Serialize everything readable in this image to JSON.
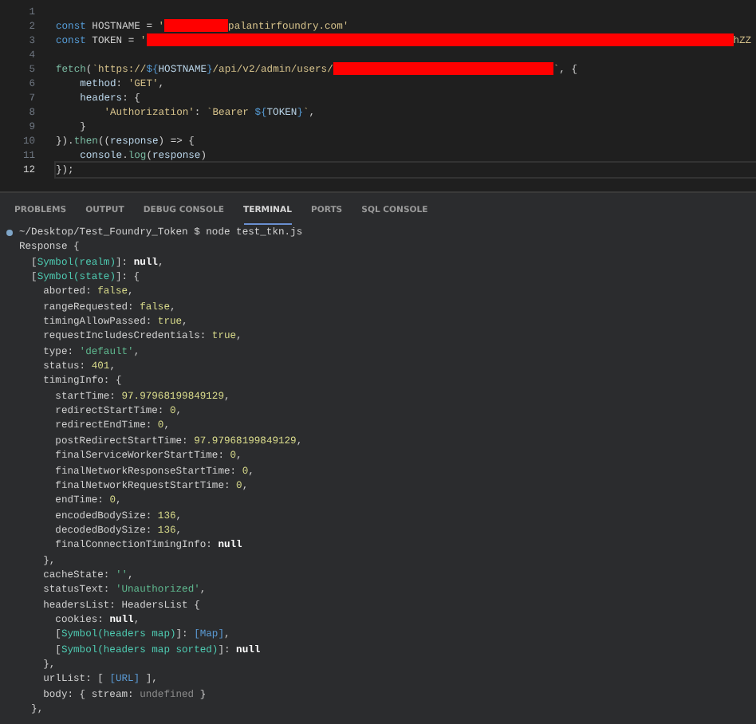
{
  "editor": {
    "lines": [
      {
        "number": "1",
        "current": false
      },
      {
        "number": "2",
        "current": false,
        "segments": [
          {
            "kind": "keyword",
            "text": "const"
          },
          {
            "kind": "plain",
            "text": " HOSTNAME = "
          },
          {
            "kind": "string",
            "text": "'"
          },
          {
            "kind": "shortredaction"
          },
          {
            "kind": "string",
            "text": "palantirfoundry.com'"
          }
        ]
      },
      {
        "number": "3",
        "current": false,
        "segments": [
          {
            "kind": "keyword",
            "text": "const"
          },
          {
            "kind": "plain",
            "text": " TOKEN = "
          },
          {
            "kind": "string",
            "text": "'"
          },
          {
            "kind": "longredaction"
          },
          {
            "kind": "string",
            "text": "hZZ"
          }
        ]
      },
      {
        "number": "4",
        "current": false
      },
      {
        "number": "5",
        "current": false,
        "segments": [
          {
            "kind": "function",
            "text": "fetch"
          },
          {
            "kind": "plain",
            "text": "("
          },
          {
            "kind": "string",
            "text": "`https://"
          },
          {
            "kind": "keyword",
            "text": "${"
          },
          {
            "kind": "property",
            "text": "HOSTNAME"
          },
          {
            "kind": "keyword",
            "text": "}"
          },
          {
            "kind": "string",
            "text": "/api/v2/admin/users/"
          },
          {
            "kind": "midredaction"
          },
          {
            "kind": "string",
            "text": "`"
          },
          {
            "kind": "plain",
            "text": ", {"
          }
        ]
      },
      {
        "number": "6",
        "current": false,
        "segments": [
          {
            "kind": "property",
            "text": "    method"
          },
          {
            "kind": "plain",
            "text": ": "
          },
          {
            "kind": "string",
            "text": "'GET'"
          },
          {
            "kind": "plain",
            "text": ","
          }
        ]
      },
      {
        "number": "7",
        "current": false,
        "segments": [
          {
            "kind": "property",
            "text": "    headers"
          },
          {
            "kind": "plain",
            "text": ": {"
          }
        ]
      },
      {
        "number": "8",
        "current": false,
        "segments": [
          {
            "kind": "string",
            "text": "        'Authorization'"
          },
          {
            "kind": "plain",
            "text": ": "
          },
          {
            "kind": "string",
            "text": "`Bearer "
          },
          {
            "kind": "keyword",
            "text": "${"
          },
          {
            "kind": "property",
            "text": "TOKEN"
          },
          {
            "kind": "keyword",
            "text": "}"
          },
          {
            "kind": "string",
            "text": "`"
          },
          {
            "kind": "plain",
            "text": ","
          }
        ]
      },
      {
        "number": "9",
        "current": false,
        "segments": [
          {
            "kind": "plain",
            "text": "    }"
          }
        ]
      },
      {
        "number": "10",
        "current": false,
        "segments": [
          {
            "kind": "plain",
            "text": "})."
          },
          {
            "kind": "function",
            "text": "then"
          },
          {
            "kind": "plain",
            "text": "(("
          },
          {
            "kind": "property",
            "text": "response"
          },
          {
            "kind": "plain",
            "text": ") => {"
          }
        ]
      },
      {
        "number": "11",
        "current": false,
        "segments": [
          {
            "kind": "property",
            "text": "    console"
          },
          {
            "kind": "plain",
            "text": "."
          },
          {
            "kind": "function",
            "text": "log"
          },
          {
            "kind": "plain",
            "text": "("
          },
          {
            "kind": "property",
            "text": "response"
          },
          {
            "kind": "plain",
            "text": ")"
          }
        ]
      },
      {
        "number": "12",
        "current": true,
        "segments": [
          {
            "kind": "plain",
            "text": "});"
          }
        ]
      }
    ]
  },
  "panel": {
    "tabs": [
      {
        "label": "PROBLEMS",
        "selected": false
      },
      {
        "label": "OUTPUT",
        "selected": false
      },
      {
        "label": "DEBUG CONSOLE",
        "selected": false
      },
      {
        "label": "TERMINAL",
        "selected": true
      },
      {
        "label": "PORTS",
        "selected": false
      },
      {
        "label": "SQL CONSOLE",
        "selected": false
      }
    ]
  },
  "terminal": {
    "prompt": {
      "path": "~/Desktop/Test_Foundry_Token",
      "symbol": "$",
      "command": "node test_tkn.js"
    },
    "lines": [
      [
        {
          "kind": "plain",
          "text": "Response {"
        }
      ],
      [
        {
          "kind": "plain",
          "text": "  ["
        },
        {
          "kind": "symbol",
          "text": "Symbol(realm)"
        },
        {
          "kind": "plain",
          "text": "]: "
        },
        {
          "kind": "null",
          "text": "null"
        },
        {
          "kind": "plain",
          "text": ","
        }
      ],
      [
        {
          "kind": "plain",
          "text": "  ["
        },
        {
          "kind": "symbol",
          "text": "Symbol(state)"
        },
        {
          "kind": "plain",
          "text": "]: {"
        }
      ],
      [
        {
          "kind": "plain",
          "text": "    aborted: "
        },
        {
          "kind": "literal",
          "text": "false"
        },
        {
          "kind": "plain",
          "text": ","
        }
      ],
      [
        {
          "kind": "plain",
          "text": "    rangeRequested: "
        },
        {
          "kind": "literal",
          "text": "false"
        },
        {
          "kind": "plain",
          "text": ","
        }
      ],
      [
        {
          "kind": "plain",
          "text": "    timingAllowPassed: "
        },
        {
          "kind": "literal",
          "text": "true"
        },
        {
          "kind": "plain",
          "text": ","
        }
      ],
      [
        {
          "kind": "plain",
          "text": "    requestIncludesCredentials: "
        },
        {
          "kind": "literal",
          "text": "true"
        },
        {
          "kind": "plain",
          "text": ","
        }
      ],
      [
        {
          "kind": "plain",
          "text": "    type: "
        },
        {
          "kind": "string",
          "text": "'default'"
        },
        {
          "kind": "plain",
          "text": ","
        }
      ],
      [
        {
          "kind": "plain",
          "text": "    status: "
        },
        {
          "kind": "literal",
          "text": "401"
        },
        {
          "kind": "plain",
          "text": ","
        }
      ],
      [
        {
          "kind": "plain",
          "text": "    timingInfo: {"
        }
      ],
      [
        {
          "kind": "plain",
          "text": "      startTime: "
        },
        {
          "kind": "literal",
          "text": "97.97968199849129"
        },
        {
          "kind": "plain",
          "text": ","
        }
      ],
      [
        {
          "kind": "plain",
          "text": "      redirectStartTime: "
        },
        {
          "kind": "literal",
          "text": "0"
        },
        {
          "kind": "plain",
          "text": ","
        }
      ],
      [
        {
          "kind": "plain",
          "text": "      redirectEndTime: "
        },
        {
          "kind": "literal",
          "text": "0"
        },
        {
          "kind": "plain",
          "text": ","
        }
      ],
      [
        {
          "kind": "plain",
          "text": "      postRedirectStartTime: "
        },
        {
          "kind": "literal",
          "text": "97.97968199849129"
        },
        {
          "kind": "plain",
          "text": ","
        }
      ],
      [
        {
          "kind": "plain",
          "text": "      finalServiceWorkerStartTime: "
        },
        {
          "kind": "literal",
          "text": "0"
        },
        {
          "kind": "plain",
          "text": ","
        }
      ],
      [
        {
          "kind": "plain",
          "text": "      finalNetworkResponseStartTime: "
        },
        {
          "kind": "literal",
          "text": "0"
        },
        {
          "kind": "plain",
          "text": ","
        }
      ],
      [
        {
          "kind": "plain",
          "text": "      finalNetworkRequestStartTime: "
        },
        {
          "kind": "literal",
          "text": "0"
        },
        {
          "kind": "plain",
          "text": ","
        }
      ],
      [
        {
          "kind": "plain",
          "text": "      endTime: "
        },
        {
          "kind": "literal",
          "text": "0"
        },
        {
          "kind": "plain",
          "text": ","
        }
      ],
      [
        {
          "kind": "plain",
          "text": "      encodedBodySize: "
        },
        {
          "kind": "literal",
          "text": "136"
        },
        {
          "kind": "plain",
          "text": ","
        }
      ],
      [
        {
          "kind": "plain",
          "text": "      decodedBodySize: "
        },
        {
          "kind": "literal",
          "text": "136"
        },
        {
          "kind": "plain",
          "text": ","
        }
      ],
      [
        {
          "kind": "plain",
          "text": "      finalConnectionTimingInfo: "
        },
        {
          "kind": "null",
          "text": "null"
        }
      ],
      [
        {
          "kind": "plain",
          "text": "    },"
        }
      ],
      [
        {
          "kind": "plain",
          "text": "    cacheState: "
        },
        {
          "kind": "string",
          "text": "''"
        },
        {
          "kind": "plain",
          "text": ","
        }
      ],
      [
        {
          "kind": "plain",
          "text": "    statusText: "
        },
        {
          "kind": "string",
          "text": "'Unauthorized'"
        },
        {
          "kind": "plain",
          "text": ","
        }
      ],
      [
        {
          "kind": "plain",
          "text": "    headersList: HeadersList {"
        }
      ],
      [
        {
          "kind": "plain",
          "text": "      cookies: "
        },
        {
          "kind": "null",
          "text": "null"
        },
        {
          "kind": "plain",
          "text": ","
        }
      ],
      [
        {
          "kind": "plain",
          "text": "      ["
        },
        {
          "kind": "symbol",
          "text": "Symbol(headers map)"
        },
        {
          "kind": "plain",
          "text": "]: "
        },
        {
          "kind": "special",
          "text": "[Map]"
        },
        {
          "kind": "plain",
          "text": ","
        }
      ],
      [
        {
          "kind": "plain",
          "text": "      ["
        },
        {
          "kind": "symbol",
          "text": "Symbol(headers map sorted)"
        },
        {
          "kind": "plain",
          "text": "]: "
        },
        {
          "kind": "null",
          "text": "null"
        }
      ],
      [
        {
          "kind": "plain",
          "text": "    },"
        }
      ],
      [
        {
          "kind": "plain",
          "text": "    urlList: [ "
        },
        {
          "kind": "special",
          "text": "[URL]"
        },
        {
          "kind": "plain",
          "text": " ],"
        }
      ],
      [
        {
          "kind": "plain",
          "text": "    body: { stream: "
        },
        {
          "kind": "undefined",
          "text": "undefined"
        },
        {
          "kind": "plain",
          "text": " }"
        }
      ],
      [
        {
          "kind": "plain",
          "text": "  },"
        }
      ]
    ]
  }
}
